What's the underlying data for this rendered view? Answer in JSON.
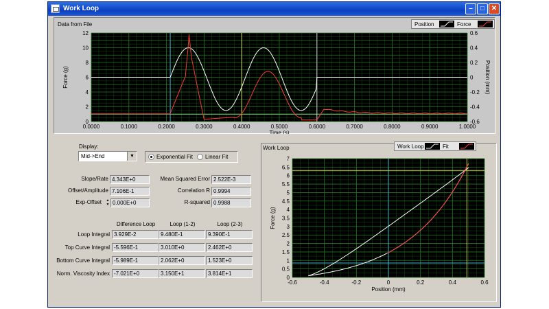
{
  "window": {
    "title": "Work Loop"
  },
  "top_plot": {
    "title": "Data from File",
    "legend": {
      "position_label": "Position",
      "force_label": "Force"
    },
    "ylabel_left": "Force (g)",
    "ylabel_right": "Position (mm)",
    "xlabel": "Time (s)",
    "x_ticks": [
      "0.0000",
      "0.1000",
      "0.2000",
      "0.3000",
      "0.4000",
      "0.5000",
      "0.6000",
      "0.7000",
      "0.8000",
      "0.9000",
      "1.0000"
    ],
    "y_left_ticks": [
      "0",
      "2",
      "4",
      "6",
      "8",
      "10",
      "12"
    ],
    "y_right_ticks": [
      "-0.6",
      "-0.5",
      "-0.4",
      "-0.3",
      "-0.2",
      "-0.1",
      "0",
      "0.1",
      "0.2",
      "0.3",
      "0.4",
      "0.5",
      "0.6"
    ]
  },
  "controls": {
    "display_label": "Display:",
    "display_value": "Mid->End",
    "exponential_label": "Exponential Fit",
    "linear_label": "Linear Fit",
    "slope_label": "Slope/Rate",
    "slope_value": "4.343E+0",
    "offset_label": "Offset/Amplitude",
    "offset_value": "7.106E-1",
    "expoffset_label": "Exp-Offset",
    "expoffset_value": "0.000E+0",
    "mse_label": "Mean Squared Error",
    "mse_value": "2.522E-3",
    "corr_label": "Correlation R",
    "corr_value": "0.9994",
    "rsq_label": "R-squared",
    "rsq_value": "0.9988"
  },
  "loop_table": {
    "headers": [
      "Difference Loop",
      "Loop (1-2)",
      "Loop (2-3)"
    ],
    "rows": [
      {
        "label": "Loop Integral",
        "values": [
          "3.929E-2",
          "9.480E-1",
          "9.390E-1"
        ]
      },
      {
        "label": "Top Curve Integral",
        "values": [
          "-5.596E-1",
          "3.010E+0",
          "2.462E+0"
        ]
      },
      {
        "label": "Bottom Curve Integral",
        "values": [
          "-5.989E-1",
          "2.062E+0",
          "1.523E+0"
        ]
      },
      {
        "label": "Norm. Viscosity Index",
        "values": [
          "-7.021E+0",
          "3.150E+1",
          "3.814E+1"
        ]
      }
    ]
  },
  "work_plot": {
    "title": "Work Loop",
    "legend": {
      "loop_label": "Work Loop",
      "fit_label": "Fit"
    },
    "ylabel": "Force (g)",
    "xlabel": "Position (mm)",
    "x_ticks": [
      "-0.6",
      "-0.4",
      "-0.2",
      "0",
      "0.2",
      "0.4",
      "0.6"
    ],
    "y_ticks": [
      "0",
      "0.5",
      "1",
      "1.5",
      "2",
      "2.5",
      "3",
      "3.5",
      "4",
      "4.5",
      "5",
      "5.5",
      "6",
      "6.5",
      "7"
    ]
  },
  "colors": {
    "plot_bg": "#000000",
    "grid": "#1e7a1e",
    "position_trace": "#ffffff",
    "force_trace": "#ff3a3a",
    "cursor_cyan": "#3ab4d8",
    "cursor_yellow": "#d6d640",
    "baseline_green": "#66e066"
  }
}
